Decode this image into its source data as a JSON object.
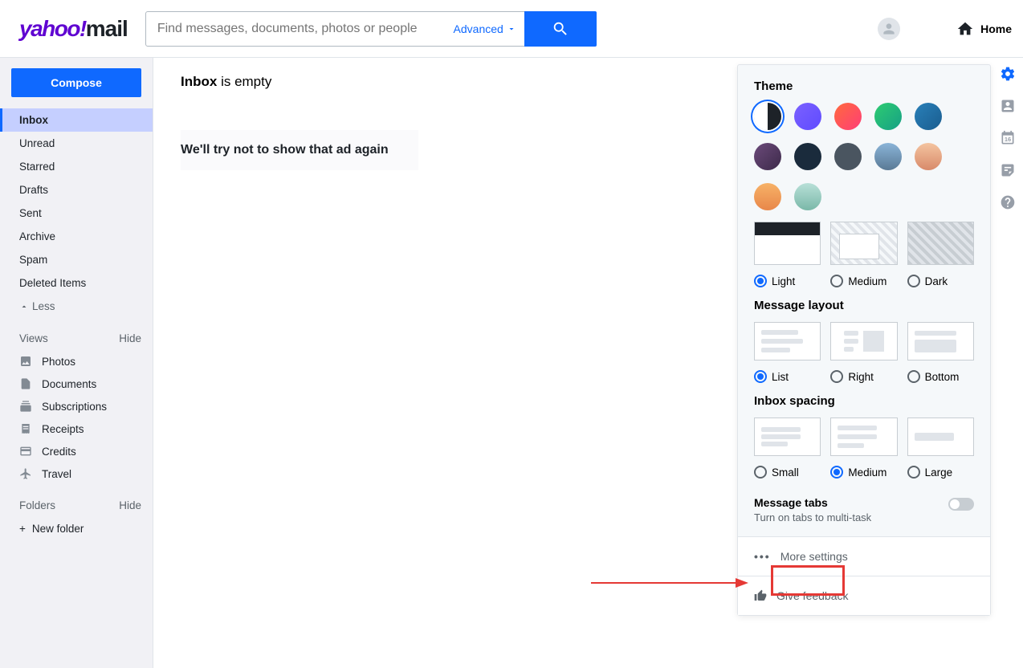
{
  "logo": {
    "yahoo": "yahoo!",
    "mail": "mail"
  },
  "search": {
    "placeholder": "Find messages, documents, photos or people",
    "advanced": "Advanced"
  },
  "header": {
    "home": "Home"
  },
  "compose": "Compose",
  "folders": [
    "Inbox",
    "Unread",
    "Starred",
    "Drafts",
    "Sent",
    "Archive",
    "Spam",
    "Deleted Items"
  ],
  "less": "Less",
  "views_hdr": "Views",
  "hide": "Hide",
  "views": [
    "Photos",
    "Documents",
    "Subscriptions",
    "Receipts",
    "Credits",
    "Travel"
  ],
  "folders_hdr": "Folders",
  "newfolder": "New folder",
  "inbox": {
    "title": "Inbox",
    "empty": " is empty"
  },
  "ad": "We'll try not to show that ad again",
  "settings": {
    "theme": "Theme",
    "theme_opts": [
      "Light",
      "Medium",
      "Dark"
    ],
    "layout": "Message layout",
    "layout_opts": [
      "List",
      "Right",
      "Bottom"
    ],
    "spacing": "Inbox spacing",
    "spacing_opts": [
      "Small",
      "Medium",
      "Large"
    ],
    "tabs_t": "Message tabs",
    "tabs_s": "Turn on tabs to multi-task",
    "more": "More settings",
    "feedback": "Give feedback"
  }
}
